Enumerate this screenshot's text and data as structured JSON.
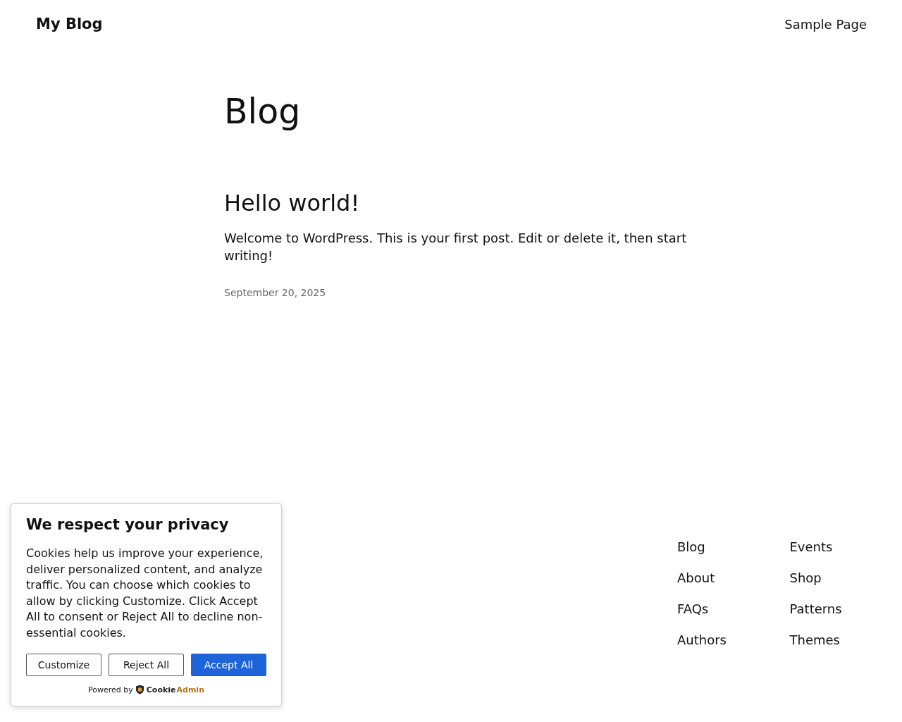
{
  "site": {
    "title": "My Blog",
    "nav": [
      "Sample Page"
    ]
  },
  "page": {
    "title": "Blog"
  },
  "posts": [
    {
      "title": "Hello world!",
      "excerpt": "Welcome to WordPress. This is your first post. Edit or delete it, then start writing!",
      "date": "September 20, 2025"
    }
  ],
  "footer": {
    "columns": [
      [
        "Blog",
        "About",
        "FAQs",
        "Authors"
      ],
      [
        "Events",
        "Shop",
        "Patterns",
        "Themes"
      ]
    ]
  },
  "cookie_banner": {
    "title": "We respect your privacy",
    "text": "Cookies help us improve your experience, deliver personalized content, and analyze traffic. You can choose which cookies to allow by clicking Customize. Click Accept All to consent or Reject All to decline non-essential cookies.",
    "buttons": [
      {
        "label": "Customize",
        "kind": "outline"
      },
      {
        "label": "Reject All",
        "kind": "outline"
      },
      {
        "label": "Accept All",
        "kind": "primary"
      }
    ],
    "powered_by": "Powered by",
    "brand": [
      "Cookie",
      "Admin"
    ]
  }
}
